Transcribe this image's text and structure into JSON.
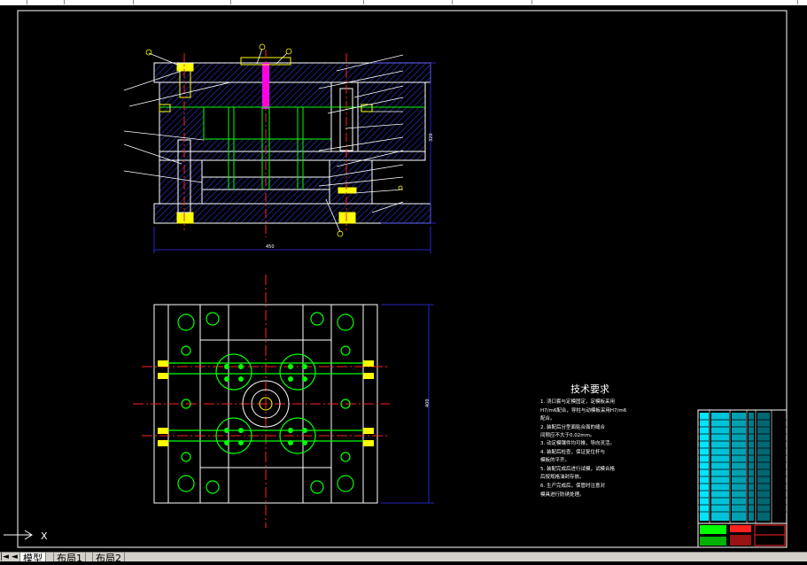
{
  "notes": {
    "title": "技术要求",
    "lines": [
      "1. 浇口套与定模固定，定模板采用",
      "H7/m6配合，导柱与动模板采用H7/m6",
      "配合。",
      "2. 装配后分型面贴合面的缝合",
      "间隙应不大于0.02mm。",
      "3. 动定模镶件均可推，导向灵活。",
      "4. 装配后检查，保证复位杆与",
      "模板的平齐。",
      "5. 装配完成后进行试模，试模合格",
      "后按规格油封存放。",
      "6. 生产完成后，保管时注意对",
      "模具进行防锈处理。"
    ]
  },
  "dimensions": {
    "front_width": "450",
    "front_height": "320",
    "plan_height": "400"
  },
  "tabs": [
    {
      "label": "模型"
    },
    {
      "label": "布局1"
    },
    {
      "label": "布局2"
    }
  ],
  "nav_arrows": "|◄ ◄ ► ►|",
  "ucs_axis_label": "X",
  "colors": {
    "background": "#000000",
    "outline": "#ffffff",
    "hatch": "#2a3bd1",
    "center": "#ff2020",
    "green": "#00ff00",
    "yellow": "#ffff00",
    "cyan": "#00e5ff",
    "magenta": "#ff00ff",
    "dim_blue": "#3030ff"
  }
}
